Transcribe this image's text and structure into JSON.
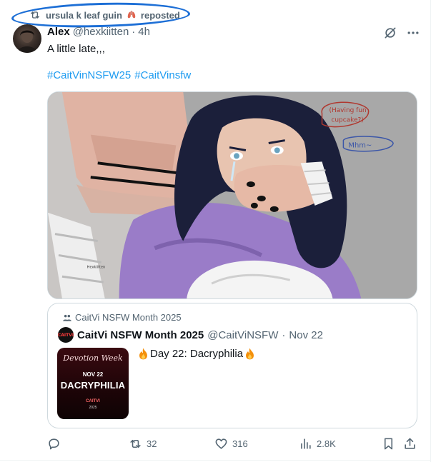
{
  "repost": {
    "user": "ursula k leaf guin",
    "emoji": "lungs-icon",
    "label": "reposted"
  },
  "tweet": {
    "author_name": "Alex",
    "author_handle": "@hexkiitten",
    "separator": "·",
    "time": "4h",
    "text": "A little late,,,",
    "hashtags": [
      "#CaitVinNSFW25",
      "#CaitVinsfw"
    ],
    "media": {
      "sketch_notes": [
        "(Having fun",
        "cupcake?)",
        "Mhm~"
      ],
      "tattoo_text": "Hexkiitten"
    }
  },
  "quote": {
    "community": "CaitVi NSFW Month 2025",
    "name": "CaitVi NSFW Month 2025",
    "handle": "@CaitViNSFW",
    "separator": "·",
    "date": "Nov 22",
    "text": "Day 22: Dacryphilia",
    "thumbnail": {
      "line1": "Devotion Week",
      "line2": "NOV 22",
      "line3": "DACRYPHILIA",
      "line4": "CAITVI",
      "line5": "2025"
    },
    "avatar_text": "CAITVI"
  },
  "actions": {
    "replies": "",
    "reposts": "32",
    "likes": "316",
    "views": "2.8K"
  },
  "colors": {
    "accent": "#1d9bf0",
    "secondary_text": "#536471",
    "annotation_oval": "#1d6fd6"
  }
}
